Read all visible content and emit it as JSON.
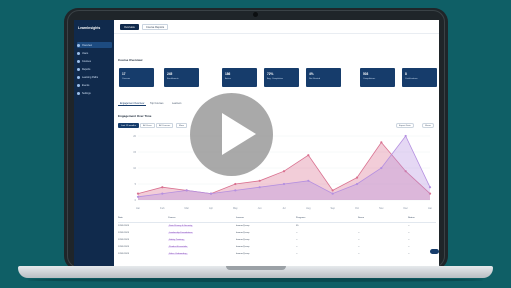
{
  "app": {
    "brand": "LearnInsights"
  },
  "sidebar": {
    "items": [
      {
        "label": "Overview",
        "active": true
      },
      {
        "label": "Users"
      },
      {
        "label": "Courses"
      },
      {
        "label": "Reports"
      },
      {
        "label": "Learning Paths"
      },
      {
        "label": "Events"
      },
      {
        "label": "Settings"
      }
    ]
  },
  "topbar": {
    "tabs": [
      {
        "label": "Overview",
        "active": true
      },
      {
        "label": "Course Reports"
      }
    ]
  },
  "overview": {
    "title": "Course Overview"
  },
  "stats": [
    {
      "value": "17",
      "label": "Courses"
    },
    {
      "value": "245",
      "label": "Enrollments"
    },
    {
      "value": "186",
      "label": "Active"
    },
    {
      "value": "72%",
      "label": "Avg. Completion"
    },
    {
      "value": "4%",
      "label": "Not Started"
    },
    {
      "value": "503",
      "label": "Completions"
    },
    {
      "value": "8",
      "label": "Certifications"
    }
  ],
  "subtabs": [
    {
      "label": "Engagement Overview",
      "active": true
    },
    {
      "label": "Top Courses"
    },
    {
      "label": "Learners"
    }
  ],
  "chart_section": {
    "title": "Engagement Over Time"
  },
  "filters": [
    {
      "label": "Last 12 months",
      "active": true
    },
    {
      "label": "All Users"
    },
    {
      "label": "All Courses"
    },
    {
      "label": "More"
    }
  ],
  "actions": [
    {
      "label": "Export Data"
    },
    {
      "label": "Share"
    }
  ],
  "chart_data": {
    "type": "area",
    "x": [
      "Jan",
      "Feb",
      "Mar",
      "Apr",
      "May",
      "Jun",
      "Jul",
      "Aug",
      "Sep",
      "Oct",
      "Nov",
      "Dec",
      "Jan"
    ],
    "series": [
      {
        "values": [
          2,
          4,
          3,
          2,
          5,
          6,
          9,
          14,
          3,
          7,
          18,
          9,
          2
        ],
        "color": "#d9708f"
      },
      {
        "values": [
          1,
          2,
          3,
          2,
          3,
          4,
          5,
          6,
          2,
          5,
          10,
          20,
          4
        ],
        "color": "#b48fe0"
      }
    ],
    "ylim": [
      0,
      20
    ],
    "grid": true
  },
  "table": {
    "headers": [
      "Date",
      "Course",
      "Learner",
      "Progress",
      "Score",
      "Status"
    ],
    "rows": [
      [
        "12/01/2023",
        "Data Privacy & Security",
        "learner@corp",
        "35",
        "",
        "--"
      ],
      [
        "12/01/2023",
        "Leadership Foundations",
        "learner@corp",
        "--",
        "--",
        "--"
      ],
      [
        "12/01/2023",
        "Safety Training",
        "learner@corp",
        "--",
        "--",
        "--"
      ],
      [
        "12/01/2023",
        "Product Essentials",
        "learner@corp",
        "--",
        "--",
        "--"
      ],
      [
        "12/01/2023",
        "Sales Onboarding",
        "learner@corp",
        "--",
        "--",
        "--"
      ]
    ]
  },
  "video": {
    "play_label": ""
  },
  "theme": {
    "bg": "#0f5f66",
    "navy": "#163c6b",
    "pink": "#d9708f",
    "lavender": "#b48fe0"
  }
}
